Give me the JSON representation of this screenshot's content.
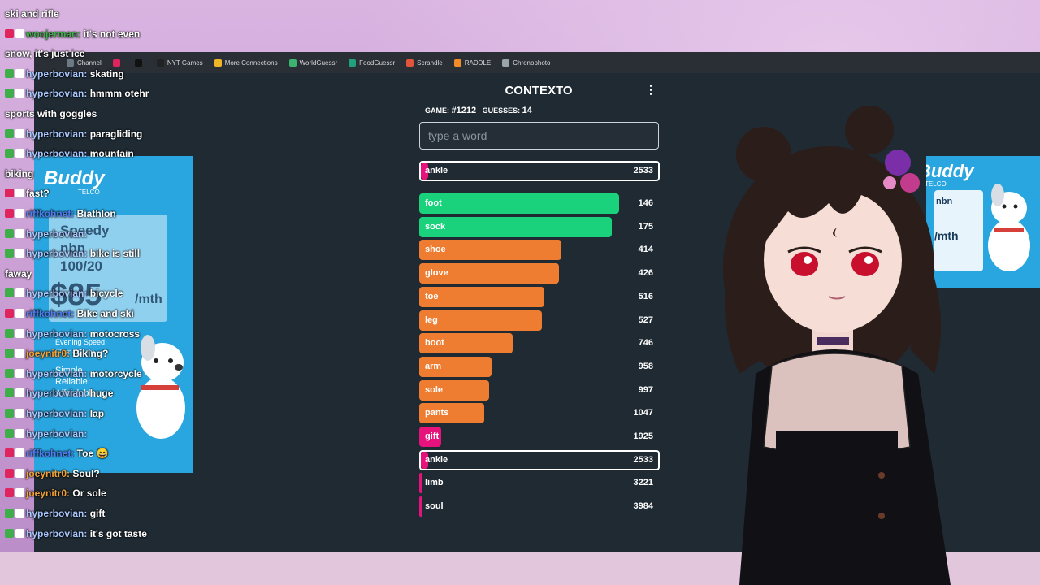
{
  "bookmarks": [
    {
      "label": "Channel",
      "color": "#6c7a86"
    },
    {
      "label": "",
      "color": "#e0245e"
    },
    {
      "label": "",
      "color": "#111111"
    },
    {
      "label": "NYT Games",
      "color": "#222222"
    },
    {
      "label": "More Connections",
      "color": "#f0b429"
    },
    {
      "label": "WorldGuessr",
      "color": "#3cb371"
    },
    {
      "label": "FoodGuessr",
      "color": "#21a179"
    },
    {
      "label": "Scrandle",
      "color": "#e2553c"
    },
    {
      "label": "RADDLE",
      "color": "#f28c28"
    },
    {
      "label": "Chronophoto",
      "color": "#9aa4ad"
    }
  ],
  "game": {
    "title": "CONTEXTO",
    "menu_icon": "⋮",
    "game_label": "GAME:",
    "game_number": "#1212",
    "guesses_label": "GUESSES:",
    "guesses_count": "14",
    "input_placeholder": "type a word",
    "last_guess": {
      "word": "ankle",
      "rank": "2533",
      "fill": 0.03,
      "color": "#e8127c"
    },
    "guesses": [
      {
        "word": "foot",
        "rank": "146",
        "fill": 0.83,
        "color": "#19d27b"
      },
      {
        "word": "sock",
        "rank": "175",
        "fill": 0.8,
        "color": "#19d27b"
      },
      {
        "word": "shoe",
        "rank": "414",
        "fill": 0.59,
        "color": "#ef7d31"
      },
      {
        "word": "glove",
        "rank": "426",
        "fill": 0.58,
        "color": "#ef7d31"
      },
      {
        "word": "toe",
        "rank": "516",
        "fill": 0.52,
        "color": "#ef7d31"
      },
      {
        "word": "leg",
        "rank": "527",
        "fill": 0.51,
        "color": "#ef7d31"
      },
      {
        "word": "boot",
        "rank": "746",
        "fill": 0.39,
        "color": "#ef7d31"
      },
      {
        "word": "arm",
        "rank": "958",
        "fill": 0.3,
        "color": "#ef7d31"
      },
      {
        "word": "sole",
        "rank": "997",
        "fill": 0.29,
        "color": "#ef7d31"
      },
      {
        "word": "pants",
        "rank": "1047",
        "fill": 0.27,
        "color": "#ef7d31"
      },
      {
        "word": "gift",
        "rank": "1925",
        "fill": 0.09,
        "color": "#e8127c"
      },
      {
        "word": "ankle",
        "rank": "2533",
        "fill": 0.03,
        "color": "#e8127c",
        "current": true
      },
      {
        "word": "limb",
        "rank": "3221",
        "fill": 0.01,
        "color": "#e8127c"
      },
      {
        "word": "soul",
        "rank": "3984",
        "fill": 0.01,
        "color": "#e8127c"
      }
    ]
  },
  "chat": [
    {
      "user": "",
      "text": "ski and rifle",
      "ucolor": "#8fd1ff",
      "badge": ""
    },
    {
      "user": "woojerman:",
      "text": "it's not even",
      "ucolor": "#3fae4a",
      "badge": "#e0245e"
    },
    {
      "user": "",
      "text": "snow, it's just ice",
      "ucolor": "#8fd1ff",
      "badge": ""
    },
    {
      "user": "hyperbovian:",
      "text": "skating",
      "ucolor": "#a9c7ff",
      "badge": "#3fae4a"
    },
    {
      "user": "hyperbovian:",
      "text": "hmmm otehr",
      "ucolor": "#a9c7ff",
      "badge": "#3fae4a"
    },
    {
      "user": "",
      "text": "sports with goggles",
      "ucolor": "#8fd1ff",
      "badge": ""
    },
    {
      "user": "hyperbovian:",
      "text": "paragliding",
      "ucolor": "#a9c7ff",
      "badge": "#3fae4a"
    },
    {
      "user": "hyperbovian:",
      "text": "mountain",
      "ucolor": "#a9c7ff",
      "badge": "#3fae4a"
    },
    {
      "user": "",
      "text": "biking",
      "ucolor": "#8fd1ff",
      "badge": ""
    },
    {
      "user": "",
      "text": "fast?",
      "ucolor": "#8fd1ff",
      "badge": "#e0245e"
    },
    {
      "user": "riffkohnet:",
      "text": "Biathlon",
      "ucolor": "#4f7df2",
      "badge": "#e0245e"
    },
    {
      "user": "hyperbovian:",
      "text": "",
      "ucolor": "#a9c7ff",
      "badge": "#3fae4a"
    },
    {
      "user": "hyperbovian:",
      "text": "bike is still",
      "ucolor": "#a9c7ff",
      "badge": "#3fae4a"
    },
    {
      "user": "",
      "text": "faway",
      "ucolor": "#8fd1ff",
      "badge": ""
    },
    {
      "user": "hyperbovian:",
      "text": "bicycle",
      "ucolor": "#a9c7ff",
      "badge": "#3fae4a"
    },
    {
      "user": "riffkohnet:",
      "text": "Bike and ski",
      "ucolor": "#4f7df2",
      "badge": "#e0245e"
    },
    {
      "user": "hyperbovian:",
      "text": "motocross",
      "ucolor": "#a9c7ff",
      "badge": "#3fae4a"
    },
    {
      "user": "joeynitr0:",
      "text": "Biking?",
      "ucolor": "#f0a33a",
      "badge": "#3fae4a"
    },
    {
      "user": "hyperbovian:",
      "text": "motorcycle",
      "ucolor": "#a9c7ff",
      "badge": "#3fae4a"
    },
    {
      "user": "hyperbovian:",
      "text": "huge",
      "ucolor": "#a9c7ff",
      "badge": "#3fae4a"
    },
    {
      "user": "hyperbovian:",
      "text": "lap",
      "ucolor": "#a9c7ff",
      "badge": "#3fae4a"
    },
    {
      "user": "hyperbovian:",
      "text": "",
      "ucolor": "#a9c7ff",
      "badge": "#3fae4a"
    },
    {
      "user": "riffkohnet:",
      "text": "Toe 😄",
      "ucolor": "#4f7df2",
      "badge": "#e0245e"
    },
    {
      "user": "joeynitr0:",
      "text": "Soul?",
      "ucolor": "#f0a33a",
      "badge": "#e0245e"
    },
    {
      "user": "joeynitr0:",
      "text": "Or sole",
      "ucolor": "#f0a33a",
      "badge": "#e0245e"
    },
    {
      "user": "hyperbovian:",
      "text": "gift",
      "ucolor": "#a9c7ff",
      "badge": "#3fae4a"
    },
    {
      "user": "hyperbovian:",
      "text": "it's got taste",
      "ucolor": "#a9c7ff",
      "badge": "#3fae4a"
    }
  ],
  "ad": {
    "brand": "Buddy",
    "brand_sub": "TELCO",
    "plan": "Speedy",
    "plan2": "nbn",
    "speed": "100/20",
    "price": "$85",
    "period": "/mth",
    "feature1": "Evening Speed",
    "feature2": "(7pm-11pm)",
    "tagline1": "Simple.",
    "tagline2": "Reliable.",
    "tagline3": "Affordable"
  },
  "ad_right": {
    "brand": "Buddy",
    "brand_sub": "TELCO",
    "plan2": "nbn",
    "period": "/mth"
  }
}
